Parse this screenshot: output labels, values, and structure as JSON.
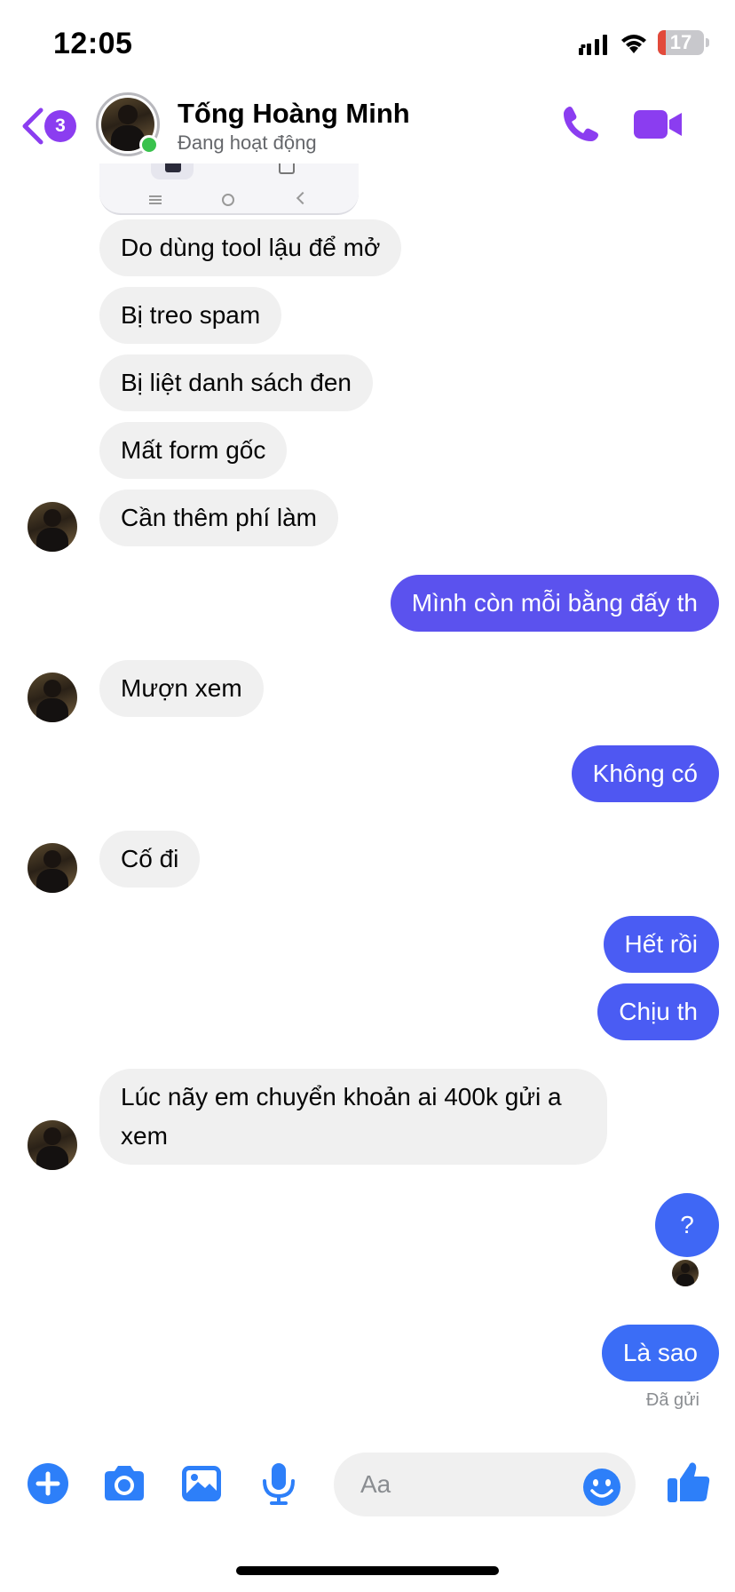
{
  "status_bar": {
    "time": "12:05",
    "battery": "17",
    "battery_level": 0.17
  },
  "header": {
    "back_badge": "3",
    "contact_name": "Tống Hoàng Minh",
    "contact_status": "Đang hoạt động",
    "accent_color": "#8b3df0"
  },
  "messages": [
    {
      "side": "received",
      "text": "Do dùng tool lậu để mở"
    },
    {
      "side": "received",
      "text": "Bị treo spam"
    },
    {
      "side": "received",
      "text": "Bị liệt danh sách đen"
    },
    {
      "side": "received",
      "text": "Mất form gốc"
    },
    {
      "side": "received",
      "text": "Cần thêm phí làm",
      "avatar": true
    },
    {
      "side": "sent",
      "text": "Mình còn mỗi bằng đấy th",
      "color": "#5b52ee"
    },
    {
      "side": "received",
      "text": "Mượn xem",
      "avatar": true
    },
    {
      "side": "sent",
      "text": "Không có",
      "color": "#4f57f2"
    },
    {
      "side": "received",
      "text": "Cố đi",
      "avatar": true
    },
    {
      "side": "sent",
      "text": "Hết rồi",
      "color": "#4a5cf3"
    },
    {
      "side": "sent",
      "text": "Chịu th",
      "color": "#4a5cf3"
    },
    {
      "side": "received",
      "text": "Lúc nãy em chuyển khoản ai 400k gửi a xem",
      "avatar": true
    },
    {
      "side": "sent",
      "text": "?",
      "color": "#3f67f5"
    },
    {
      "side": "sent",
      "text": "Là sao",
      "color": "#3b6df6"
    }
  ],
  "receipt": "Đã gửi",
  "composer": {
    "placeholder": "Aa",
    "icon_color": "#2d7ff9"
  }
}
